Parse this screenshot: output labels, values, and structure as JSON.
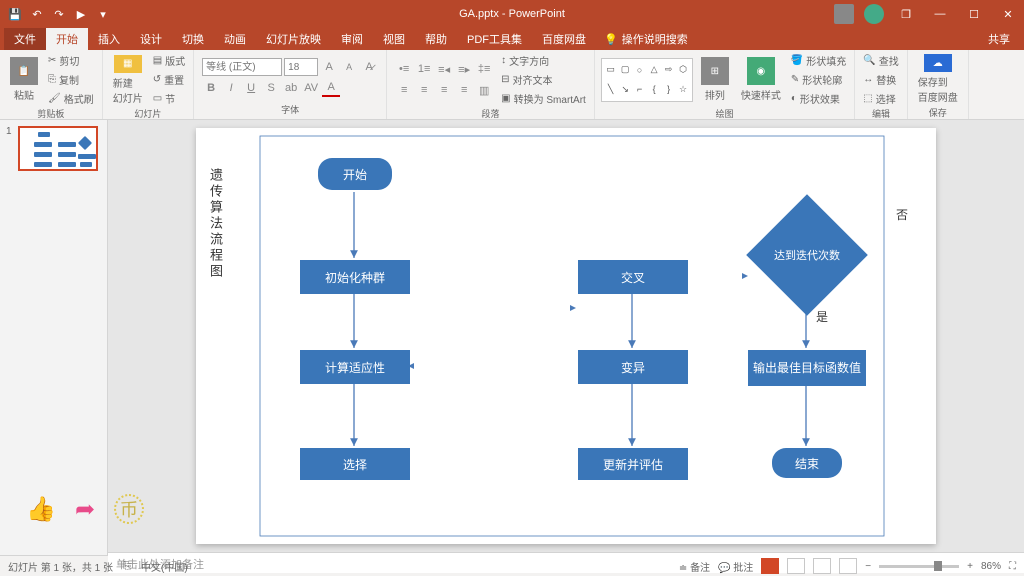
{
  "app": {
    "title": "GA.pptx - PowerPoint"
  },
  "qat": {
    "save": "💾",
    "undo": "↶",
    "redo": "↷",
    "start": "▶",
    "more": "▾"
  },
  "win": {
    "min": "—",
    "restore": "❐",
    "max": "☐",
    "close": "✕"
  },
  "tabs": {
    "file": "文件",
    "home": "开始",
    "insert": "插入",
    "design": "设计",
    "transitions": "切换",
    "animations": "动画",
    "slideshow": "幻灯片放映",
    "review": "审阅",
    "view": "视图",
    "help": "帮助",
    "pdf": "PDF工具集",
    "baidu": "百度网盘",
    "tellme": "操作说明搜索",
    "share": "共享"
  },
  "ribbon": {
    "clipboard": {
      "label": "剪贴板",
      "paste": "粘贴",
      "cut": "剪切",
      "copy": "复制",
      "painter": "格式刷"
    },
    "slides": {
      "label": "幻灯片",
      "new": "新建\n幻灯片",
      "layout": "版式",
      "reset": "重置",
      "section": "节"
    },
    "font": {
      "label": "字体",
      "family_ph": "等线 (正文)",
      "size_ph": "18"
    },
    "paragraph": {
      "label": "段落",
      "dir": "文字方向",
      "align": "对齐文本",
      "smartart": "转换为 SmartArt"
    },
    "drawing": {
      "label": "绘图",
      "arrange": "排列",
      "quick": "快速样式",
      "fill": "形状填充",
      "outline": "形状轮廓",
      "effects": "形状效果"
    },
    "editing": {
      "label": "编辑",
      "find": "查找",
      "replace": "替换",
      "select": "选择"
    },
    "save": {
      "label": "保存",
      "baidu": "保存到\n百度网盘"
    }
  },
  "slide": {
    "vtitle": "遗传算法流程图",
    "nodes": {
      "start": "开始",
      "init": "初始化种群",
      "fitness": "计算适应性",
      "select": "选择",
      "cross": "交叉",
      "mutate": "变异",
      "update": "更新并评估",
      "iter": "达到迭代次数",
      "output": "输出最佳目标函数值",
      "end": "结束"
    },
    "labels": {
      "yes": "是",
      "no": "否"
    }
  },
  "thumb": {
    "num": "1"
  },
  "notes": {
    "placeholder": "单击此处添加备注"
  },
  "status": {
    "slide_info": "幻灯片 第 1 张，共 1 张",
    "lang": "中文(中国)",
    "notes": "备注",
    "comments": "批注",
    "zoom": "86%"
  },
  "chart_data": {
    "type": "diagram",
    "title": "遗传算法流程图",
    "nodes": [
      {
        "id": "start",
        "type": "terminator",
        "label": "开始"
      },
      {
        "id": "init",
        "type": "process",
        "label": "初始化种群"
      },
      {
        "id": "fitness",
        "type": "process",
        "label": "计算适应性"
      },
      {
        "id": "select",
        "type": "process",
        "label": "选择"
      },
      {
        "id": "cross",
        "type": "process",
        "label": "交叉"
      },
      {
        "id": "mutate",
        "type": "process",
        "label": "变异"
      },
      {
        "id": "update",
        "type": "process",
        "label": "更新并评估"
      },
      {
        "id": "iter",
        "type": "decision",
        "label": "达到迭代次数"
      },
      {
        "id": "output",
        "type": "process",
        "label": "输出最佳目标函数值"
      },
      {
        "id": "end",
        "type": "terminator",
        "label": "结束"
      }
    ],
    "edges": [
      {
        "from": "start",
        "to": "init"
      },
      {
        "from": "init",
        "to": "fitness"
      },
      {
        "from": "fitness",
        "to": "select"
      },
      {
        "from": "select",
        "to": "cross"
      },
      {
        "from": "cross",
        "to": "mutate"
      },
      {
        "from": "mutate",
        "to": "update"
      },
      {
        "from": "update",
        "to": "iter"
      },
      {
        "from": "iter",
        "to": "output",
        "label": "是"
      },
      {
        "from": "iter",
        "to": "fitness",
        "label": "否",
        "route": "loop-back"
      },
      {
        "from": "output",
        "to": "end"
      }
    ]
  }
}
